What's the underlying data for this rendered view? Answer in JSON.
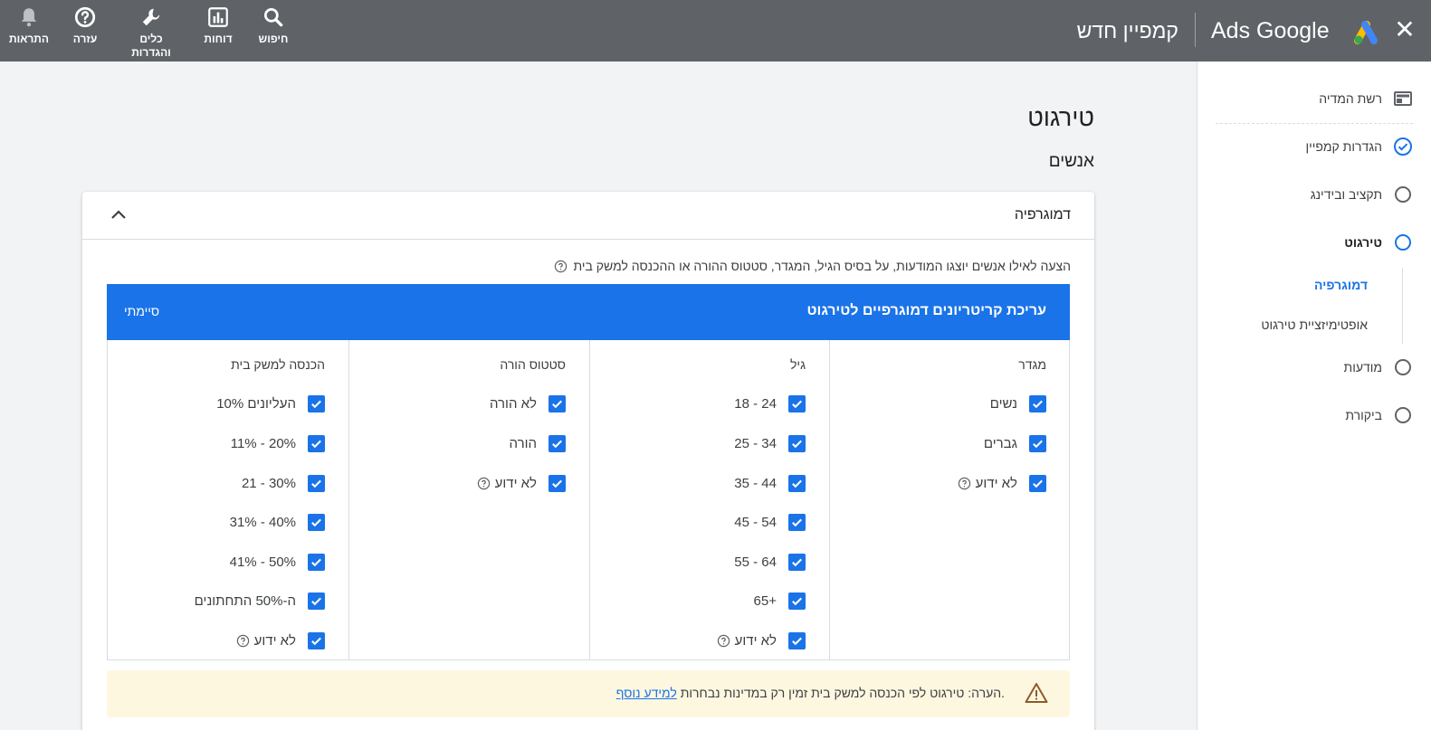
{
  "topbar": {
    "close_icon": "close-icon",
    "brand": "Ads Google",
    "page_name": "קמפיין חדש",
    "actions": [
      {
        "label": "חיפוש",
        "icon": "search-icon"
      },
      {
        "label": "דוחות",
        "icon": "reports-icon"
      },
      {
        "label": "כלים והגדרות",
        "icon": "wrench-icon"
      },
      {
        "label": "עזרה",
        "icon": "help-icon"
      },
      {
        "label": "התראות",
        "icon": "bell-icon"
      }
    ]
  },
  "sidebar": {
    "items": [
      {
        "label": "רשת המדיה",
        "icon": "display-network-icon",
        "state": "done"
      },
      {
        "label": "הגדרות קמפיין",
        "icon": "check-circle-icon",
        "state": "done"
      },
      {
        "label": "תקציב ובידינג",
        "icon": "empty-circle-icon",
        "state": "todo"
      },
      {
        "label": "טירגוט",
        "icon": "current-circle-icon",
        "state": "active"
      },
      {
        "label": "מודעות",
        "icon": "empty-circle-icon",
        "state": "todo"
      },
      {
        "label": "ביקורת",
        "icon": "empty-circle-icon",
        "state": "todo"
      }
    ],
    "sub_items": [
      {
        "label": "דמוגרפיה",
        "active": true
      },
      {
        "label": "אופטימיזציית טירגוט",
        "active": false
      }
    ]
  },
  "main": {
    "title": "טירגוט",
    "subtitle": "אנשים",
    "card": {
      "title": "דמוגרפיה",
      "description": "הצעה לאילו אנשים יוצגו המודעות, על בסיס הגיל, המגדר, סטטוס ההורה או ההכנסה למשק בית",
      "edit_bar": {
        "title": "עריכת קריטריונים דמוגרפיים לטירגוט",
        "done": "סיימתי"
      },
      "columns": [
        {
          "header": "מגדר",
          "options": [
            "נשים",
            "גברים",
            "לא ידוע"
          ]
        },
        {
          "header": "גיל",
          "options": [
            "18 - 24",
            "25 - 34",
            "35 - 44",
            "45 - 54",
            "55 - 64",
            "65+",
            "לא ידוע"
          ]
        },
        {
          "header": "סטטוס הורה",
          "options": [
            "לא הורה",
            "הורה",
            "לא ידוע"
          ]
        },
        {
          "header": "הכנסה למשק בית",
          "options": [
            "10% העליונים",
            "11% - 20%",
            "21 - 30%",
            "31% - 40%",
            "41% - 50%",
            "ה-50% התחתונים",
            "לא ידוע"
          ]
        }
      ],
      "note": {
        "text": "הערה: טירגוט לפי הכנסה למשק בית זמין רק במדינות נבחרות.",
        "link": "למידע נוסף"
      }
    }
  },
  "colors": {
    "topbar": "#5f6368",
    "accent": "#1a73e8",
    "note_bg": "#fef7e0",
    "warning": "#8d5a2b"
  }
}
